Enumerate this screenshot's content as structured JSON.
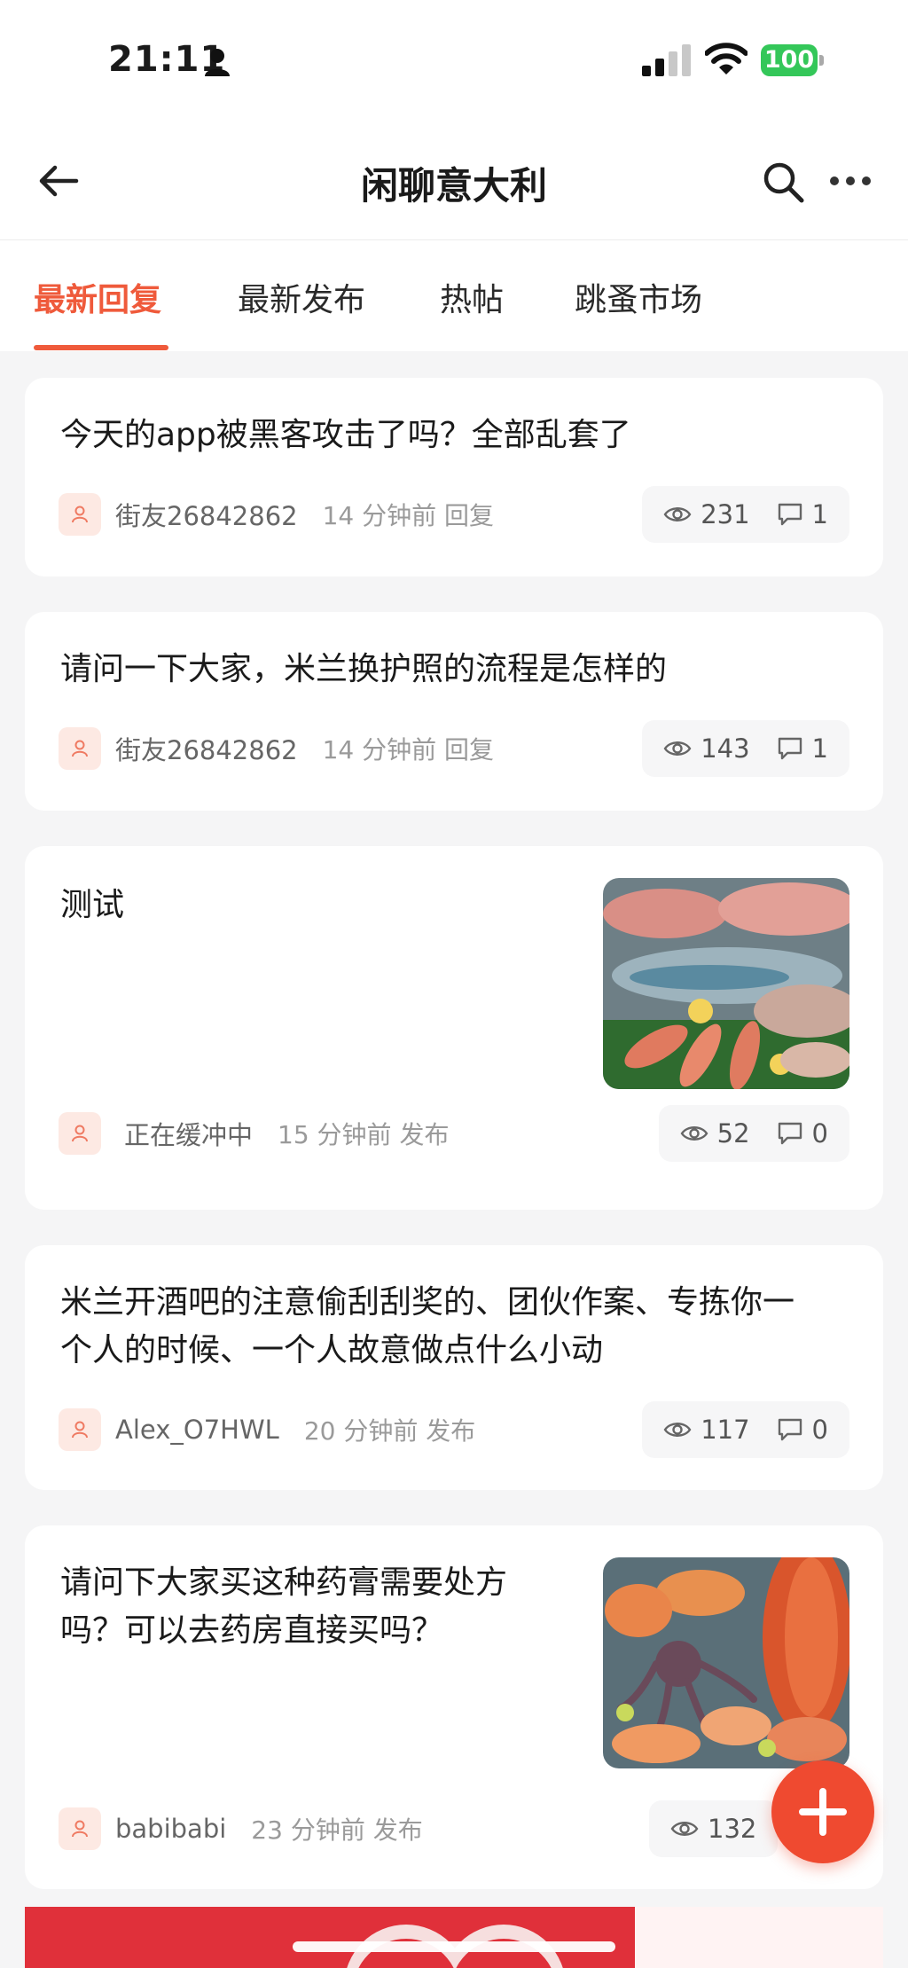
{
  "status_bar": {
    "time": "21:11",
    "battery": "100"
  },
  "header": {
    "title": "闲聊意大利"
  },
  "tabs": [
    {
      "label": "最新回复",
      "active": true
    },
    {
      "label": "最新发布",
      "active": false
    },
    {
      "label": "热帖",
      "active": false
    },
    {
      "label": "跳蚤市场",
      "active": false
    }
  ],
  "posts": [
    {
      "title": "今天的app被黑客攻击了吗？全部乱套了",
      "author": "街友26842862",
      "time": "14 分钟前 回复",
      "views": "231",
      "comments": "1"
    },
    {
      "title": "请问一下大家，米兰换护照的流程是怎样的",
      "author": "街友26842862",
      "time": "14 分钟前 回复",
      "views": "143",
      "comments": "1"
    },
    {
      "title": "测试",
      "author": "正在缓冲中",
      "time": "15 分钟前 发布",
      "views": "52",
      "comments": "0",
      "thumbnail": "fish-photo"
    },
    {
      "title_lines": [
        "米兰开酒吧的注意偷刮刮奖的、团伙作案、专拣你一",
        "个人的时候、一个人故意做点什么小动"
      ],
      "author": "Alex_O7HWL",
      "time": "20 分钟前 发布",
      "views": "117",
      "comments": "0"
    },
    {
      "title_lines": [
        "请问下大家买这种药膏需要处方",
        "吗？可以去药房直接买吗？"
      ],
      "author": "babibabi",
      "time": "23 分钟前 发布",
      "views": "132",
      "thumbnail": "seafood-photo"
    }
  ],
  "colors": {
    "accent": "#ef5a3b",
    "fab": "#ef4a30",
    "battery": "#34c759"
  },
  "icons": [
    "person-icon",
    "signal-icon",
    "wifi-icon",
    "back-arrow-icon",
    "search-icon",
    "more-icon",
    "user-icon",
    "eye-icon",
    "comment-icon",
    "plus-icon"
  ]
}
